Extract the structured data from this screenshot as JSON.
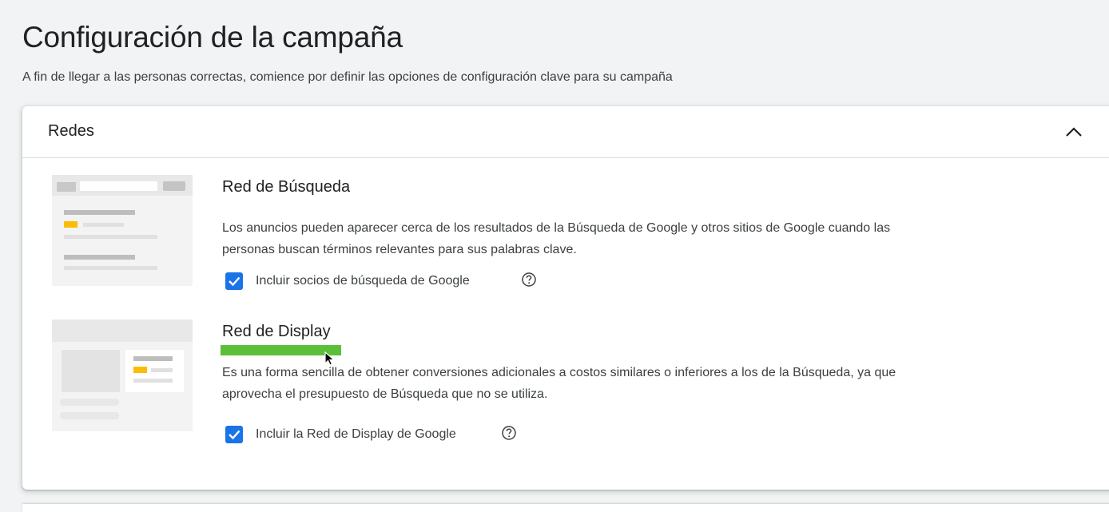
{
  "page": {
    "title": "Configuración de la campaña",
    "subtitle": "A fin de llegar a las personas correctas, comience por definir las opciones de configuración clave para su campaña"
  },
  "card": {
    "title": "Redes",
    "collapse_icon": "chevron-up-icon"
  },
  "search_network": {
    "title": "Red de Búsqueda",
    "description_line1": "Los anuncios pueden aparecer cerca de los resultados de la Búsqueda de Google y otros sitios de Google cuando las",
    "description_line2": "personas buscan términos relevantes para sus palabras clave.",
    "checkbox_label": "Incluir socios de búsqueda de Google",
    "checkbox_checked": true,
    "help_icon": "help-circle-icon"
  },
  "display_network": {
    "title": "Red de Display",
    "description_line1": "Es una forma sencilla de obtener conversiones adicionales a costos similares o inferiores a los de la Búsqueda, ya que",
    "description_line2": "aprovecha el presupuesto de Búsqueda que no se utiliza.",
    "checkbox_label": "Incluir la Red de Display de Google",
    "checkbox_checked": true,
    "help_icon": "help-circle-icon"
  },
  "colors": {
    "checkbox": "#1a73e8",
    "highlight": "#5cbf3a",
    "ad_yellow": "#fbbc04"
  }
}
